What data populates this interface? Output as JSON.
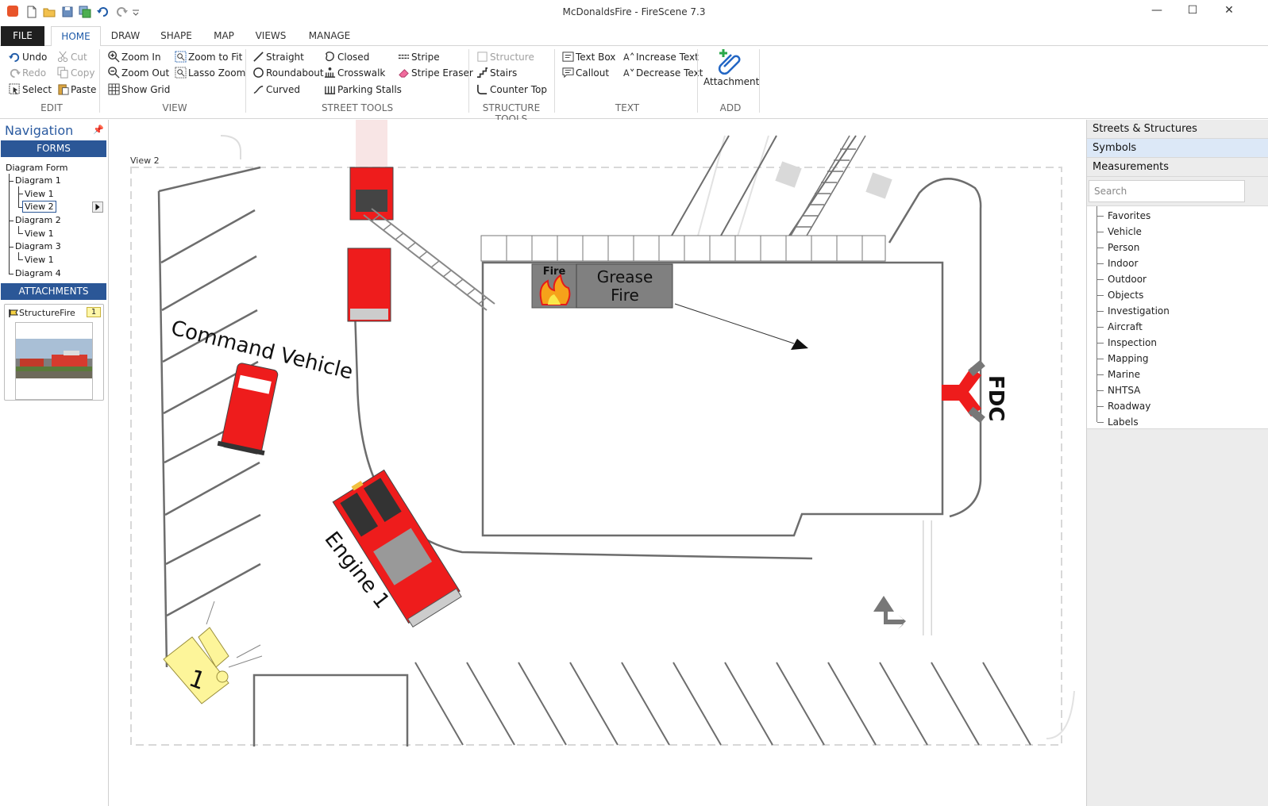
{
  "window": {
    "title": "McDonaldsFire - FireScene 7.3",
    "minimize": "—",
    "maximize": "☐",
    "close": "✕"
  },
  "tabs": [
    "FILE",
    "HOME",
    "DRAW",
    "SHAPE",
    "MAP",
    "VIEWS",
    "MANAGE"
  ],
  "ribbon": {
    "edit": {
      "label": "EDIT",
      "undo": "Undo",
      "redo": "Redo",
      "select": "Select",
      "cut": "Cut",
      "copy": "Copy",
      "paste": "Paste"
    },
    "view": {
      "label": "VIEW",
      "zoom_in": "Zoom In",
      "zoom_out": "Zoom Out",
      "show_grid": "Show Grid",
      "zoom_fit": "Zoom to Fit",
      "lasso_zoom": "Lasso Zoom"
    },
    "street_tools": {
      "label": "STREET TOOLS",
      "straight": "Straight",
      "roundabout": "Roundabout",
      "curved": "Curved",
      "closed": "Closed",
      "crosswalk": "Crosswalk",
      "parking": "Parking Stalls",
      "stripe": "Stripe",
      "stripe_eraser": "Stripe Eraser"
    },
    "structure_tools": {
      "label": "STRUCTURE TOOLS",
      "structure": "Structure",
      "stairs": "Stairs",
      "counter_top": "Counter Top"
    },
    "text": {
      "label": "TEXT",
      "text_box": "Text Box",
      "callout": "Callout",
      "increase": "Increase Text",
      "decrease": "Decrease Text"
    },
    "add": {
      "label": "ADD",
      "attachment": "Attachment"
    }
  },
  "nav": {
    "title": "Navigation",
    "pin": "📌",
    "forms_header": "FORMS",
    "tree": {
      "root": "Diagram Form",
      "d1": "Diagram 1",
      "d1v1": "View 1",
      "d1v2": "View 2",
      "d2": "Diagram 2",
      "d2v1": "View 1",
      "d3": "Diagram 3",
      "d3v1": "View 1",
      "d4": "Diagram 4"
    },
    "attachments_header": "ATTACHMENTS",
    "attachment": {
      "name": "StructureFire",
      "badge": "1"
    }
  },
  "canvas": {
    "view_label": "View 2",
    "labels": {
      "command_vehicle": "Command Vehicle",
      "engine1": "Engine 1",
      "fdc": "FDC",
      "fire_small": "Fire",
      "grease_fire_1": "Grease",
      "grease_fire_2": "Fire",
      "marker": "1"
    },
    "colors": {
      "vehicle_red": "#ee1c1c",
      "grease_box": "#808080",
      "marker_yellow": "#fdf59a",
      "road": "#6d6d6d"
    }
  },
  "right_panel": {
    "headers": [
      "Streets & Structures",
      "Symbols",
      "Measurements"
    ],
    "search_placeholder": "Search",
    "items": [
      "Favorites",
      "Vehicle",
      "Person",
      "Indoor",
      "Outdoor",
      "Objects",
      "Investigation",
      "Aircraft",
      "Inspection",
      "Mapping",
      "Marine",
      "NHTSA",
      "Roadway",
      "Labels"
    ]
  }
}
